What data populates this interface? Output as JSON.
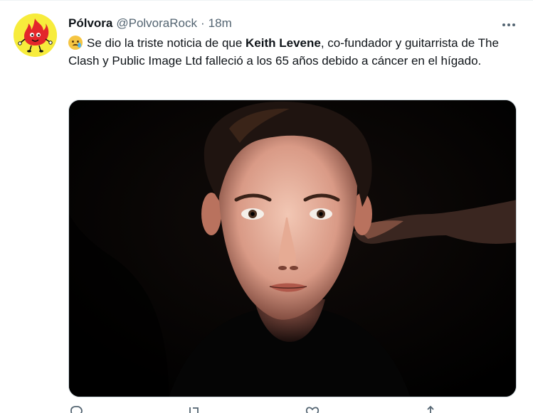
{
  "tweet": {
    "display_name": "Pólvora",
    "handle": "@PolvoraRock",
    "separator": "·",
    "time": "18m",
    "avatar_icon": "flame-character-avatar",
    "text": {
      "emoji": "smiling-face-with-tear-emoji",
      "part1": "Se dio la triste noticia de que ",
      "bold": "Keith Levene",
      "part2": ", co-fundador y guitarrista de The Clash y Public Image Ltd falleció a los 65 años debido a cáncer en el hígado."
    },
    "media": {
      "type": "photo",
      "description_icon": "portrait-photo"
    },
    "actions": [
      "reply-icon",
      "retweet-icon",
      "like-icon",
      "share-icon"
    ]
  },
  "colors": {
    "text_primary": "#0f1419",
    "text_secondary": "#536471",
    "border": "#cfd9de",
    "avatar_bg": "#f7ec3c"
  }
}
